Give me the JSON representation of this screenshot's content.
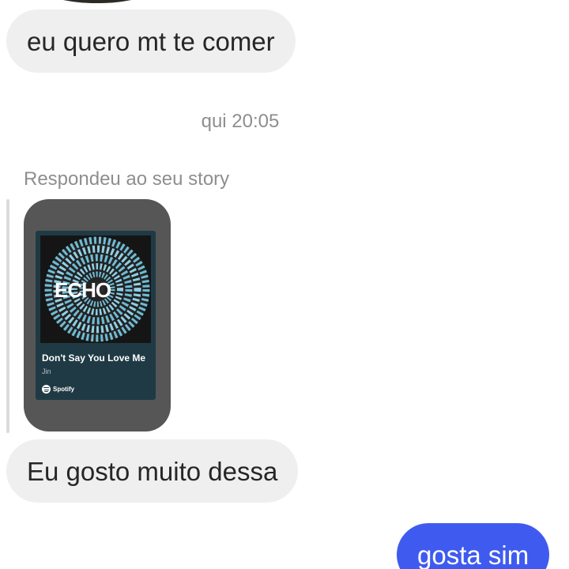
{
  "thread": {
    "messages": [
      {
        "from": "them",
        "text": "eu quero mt te comer"
      },
      {
        "from": "them",
        "text": "Eu gosto muito dessa"
      },
      {
        "from": "me",
        "text": "gosta sim"
      }
    ],
    "timestamp": "qui 20:05",
    "reply_label": "Respondeu ao seu story"
  },
  "story_card": {
    "album_logo_text": "ECHO",
    "song_title": "Don't Say You Love Me",
    "artist": "Jin",
    "service": "Spotify"
  },
  "colors": {
    "incoming_bubble": "#efefef",
    "outgoing_bubble": "#3f5bef",
    "story_bg": "#565656",
    "card_bg": "#1f3a44",
    "meta_text": "#8e8e8e"
  }
}
